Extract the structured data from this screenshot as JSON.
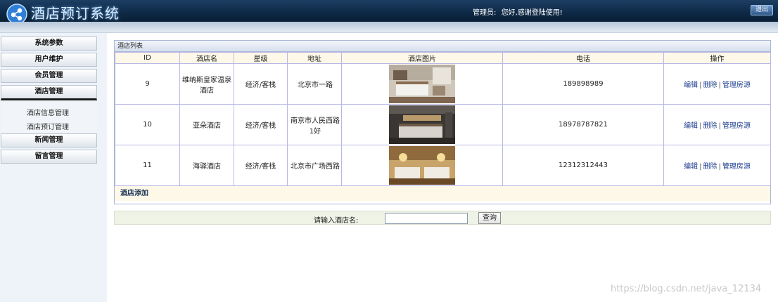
{
  "header": {
    "title": "酒店预订系统",
    "admin_label": "管理员:",
    "greeting": "您好,感谢登陆使用!",
    "logout_label": "退出"
  },
  "sidebar": {
    "menu": [
      {
        "label": "系统参数"
      },
      {
        "label": "用户维护"
      },
      {
        "label": "会员管理"
      },
      {
        "label": "酒店管理"
      },
      {
        "label": "新闻管理"
      },
      {
        "label": "留言管理"
      }
    ],
    "submenu": [
      {
        "label": "酒店信息管理"
      },
      {
        "label": "酒店预订管理"
      }
    ]
  },
  "panel": {
    "title": "酒店列表",
    "columns": [
      "ID",
      "酒店名",
      "星级",
      "地址",
      "酒店图片",
      "电话",
      "操作"
    ],
    "rows": [
      {
        "id": "9",
        "name": "维纳斯皇家温泉酒店",
        "star": "经济/客栈",
        "address": "北京市一路",
        "phone": "189898989",
        "image": "hotel-room-photo"
      },
      {
        "id": "10",
        "name": "亚朵酒店",
        "star": "经济/客栈",
        "address": "南京市人民西路1好",
        "phone": "18978787821",
        "image": "hotel-room-photo"
      },
      {
        "id": "11",
        "name": "海驿酒店",
        "star": "经济/客栈",
        "address": "北京市广场西路",
        "phone": "12312312443",
        "image": "hotel-room-photo"
      }
    ],
    "ops": {
      "edit": "编辑",
      "delete": "删除",
      "rooms": "管理房源",
      "sep": "|"
    },
    "add_label": "酒店添加"
  },
  "search": {
    "label": "请输入酒店名:",
    "value": "",
    "button": "查询"
  },
  "watermark": "https://blog.csdn.net/java_12134"
}
